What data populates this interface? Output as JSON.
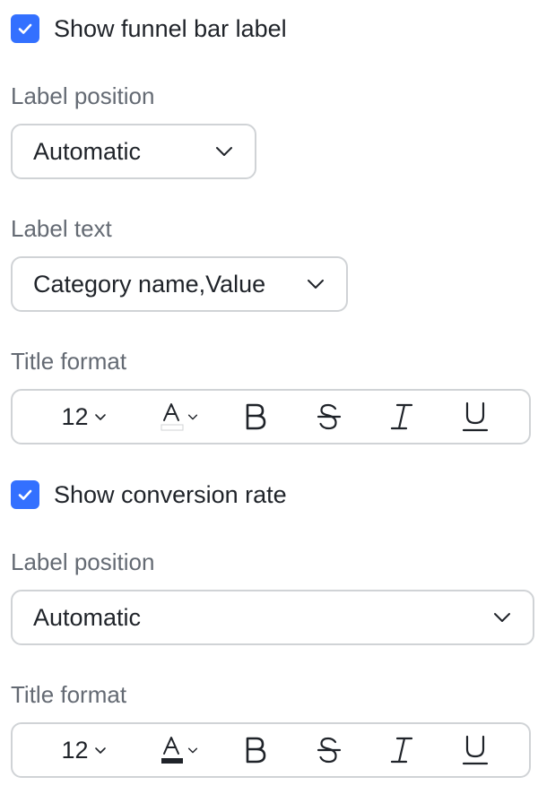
{
  "section1": {
    "show_funnel_bar_label": {
      "label": "Show funnel bar label",
      "checked": true
    },
    "label_position": {
      "label": "Label position",
      "value": "Automatic"
    },
    "label_text": {
      "label": "Label text",
      "value": "Category name,Value"
    },
    "title_format": {
      "label": "Title format",
      "font_size": "12",
      "font_color_icon": "font-color-icon",
      "font_color_underline": "#e3e5e8",
      "bold_icon": "bold-icon",
      "strikethrough_icon": "strikethrough-icon",
      "italic_icon": "italic-icon",
      "underline_icon": "underline-icon"
    }
  },
  "section2": {
    "show_conversion_rate": {
      "label": "Show conversion rate",
      "checked": true
    },
    "label_position": {
      "label": "Label position",
      "value": "Automatic"
    },
    "title_format": {
      "label": "Title format",
      "font_size": "12",
      "font_color_icon": "font-color-icon",
      "font_color_underline": "#1f2329",
      "bold_icon": "bold-icon",
      "strikethrough_icon": "strikethrough-icon",
      "italic_icon": "italic-icon",
      "underline_icon": "underline-icon"
    }
  },
  "colors": {
    "accent": "#3370ff",
    "text": "#1f2329",
    "label": "#646a73",
    "border": "#d0d3d6"
  }
}
